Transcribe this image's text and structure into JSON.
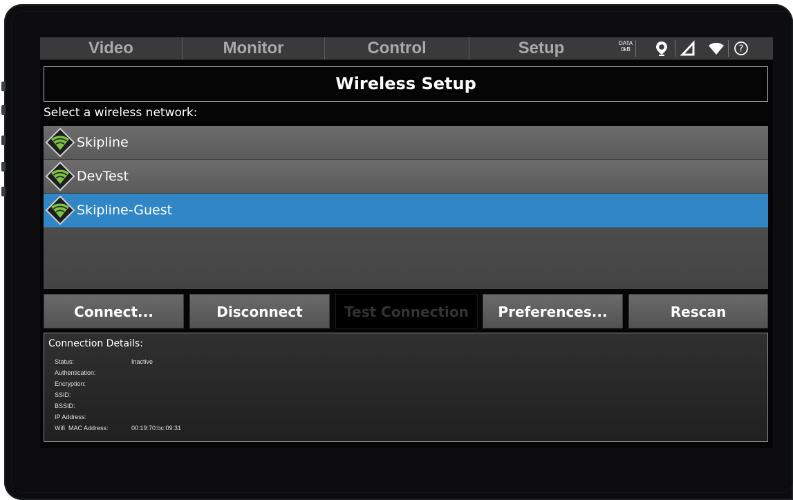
{
  "tabs": [
    {
      "label": "Video"
    },
    {
      "label": "Monitor"
    },
    {
      "label": "Control"
    },
    {
      "label": "Setup"
    }
  ],
  "status": {
    "data_label": "DATA",
    "data_value": "0kB",
    "icons": [
      "location-pin-icon",
      "signal-strength-icon",
      "wifi-icon",
      "help-icon"
    ]
  },
  "page_title": "Wireless Setup",
  "prompt": "Select a wireless network:",
  "networks": [
    {
      "name": "Skipline",
      "selected": false
    },
    {
      "name": "DevTest",
      "selected": false
    },
    {
      "name": "Skipline-Guest",
      "selected": true
    }
  ],
  "buttons": {
    "connect": "Connect...",
    "disconnect": "Disconnect",
    "test_connection": "Test Connection",
    "preferences": "Preferences...",
    "rescan": "Rescan"
  },
  "details": {
    "heading": "Connection Details:",
    "rows": [
      {
        "label": "Status:",
        "value": "Inactive"
      },
      {
        "label": "Authentication:",
        "value": ""
      },
      {
        "label": "Encryption:",
        "value": ""
      },
      {
        "label": "SSID:",
        "value": ""
      },
      {
        "label": "BSSID:",
        "value": ""
      },
      {
        "label": "IP Address:",
        "value": ""
      },
      {
        "label": "Wifi  MAC Address:",
        "value": "00:19:70:bc:09:31"
      }
    ]
  },
  "colors": {
    "selected_row": "#3186c6",
    "wifi_green": "#7cc243",
    "tab_text": "#a9a9a9"
  }
}
